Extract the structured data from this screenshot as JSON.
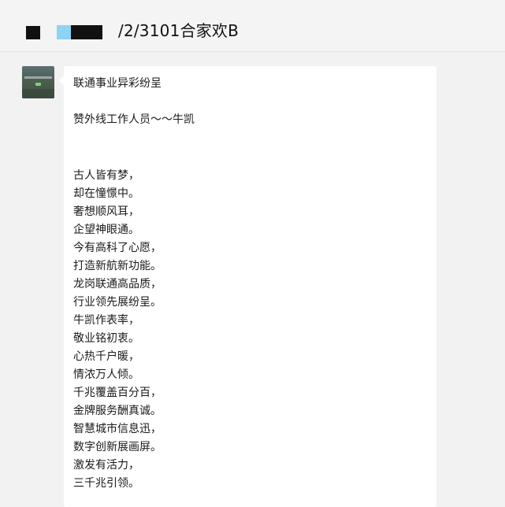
{
  "header": {
    "title": "/2/3101合家欢B"
  },
  "message": {
    "lines": [
      "联通事业异彩纷呈",
      "赞外线工作人员～～牛凯",
      "古人皆有梦，",
      "却在憧憬中。",
      "奢想顺风耳，",
      "企望神眼通。",
      "今有高科了心愿，",
      "打造新航新功能。",
      "龙岗联通高品质，",
      "行业领先展纷呈。",
      "牛凯作表率，",
      "敬业铭初衷。",
      "心热千户暖，",
      "情浓万人倾。",
      "千兆覆盖百分百，",
      "金牌服务酬真诚。",
      "智慧城市信息迅，",
      "数字创新展画屏。",
      "激发有活力，",
      "三千兆引领。"
    ]
  }
}
